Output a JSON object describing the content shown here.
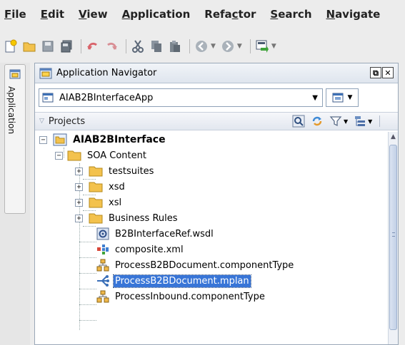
{
  "menubar": {
    "items": [
      {
        "mnemonic": "F",
        "rest": "ile"
      },
      {
        "mnemonic": "E",
        "rest": "dit"
      },
      {
        "mnemonic": "V",
        "rest": "iew"
      },
      {
        "mnemonic": "A",
        "rest": "pplication"
      },
      {
        "pre": "Refa",
        "mnemonic": "c",
        "rest": "tor"
      },
      {
        "mnemonic": "S",
        "rest": "earch"
      },
      {
        "mnemonic": "N",
        "rest": "avigate"
      }
    ]
  },
  "side_tab": {
    "label": "Application"
  },
  "navigator": {
    "title": "Application Navigator",
    "app_name": "AIAB2BInterfaceApp",
    "projects_label": "Projects"
  },
  "tree": [
    {
      "label": "AIAB2BInterface",
      "icon": "project-folder-icon"
    },
    {
      "label": "SOA Content",
      "icon": "folder-icon"
    },
    {
      "label": "testsuites",
      "icon": "folder-icon"
    },
    {
      "label": "xsd",
      "icon": "folder-icon"
    },
    {
      "label": "xsl",
      "icon": "folder-icon"
    },
    {
      "label": "Business Rules",
      "icon": "folder-icon"
    },
    {
      "label": "B2BInterfaceRef.wsdl",
      "icon": "wsdl-icon"
    },
    {
      "label": "composite.xml",
      "icon": "composite-icon"
    },
    {
      "label": "ProcessB2BDocument.componentType",
      "icon": "component-type-icon"
    },
    {
      "label": "ProcessB2BDocument.mplan",
      "icon": "mplan-icon"
    },
    {
      "label": "ProcessInbound.componentType",
      "icon": "component-type-icon"
    }
  ],
  "colors": {
    "selection": "#3875d7",
    "folder": "#f3c24d",
    "panel_border": "#9aa8b8"
  }
}
